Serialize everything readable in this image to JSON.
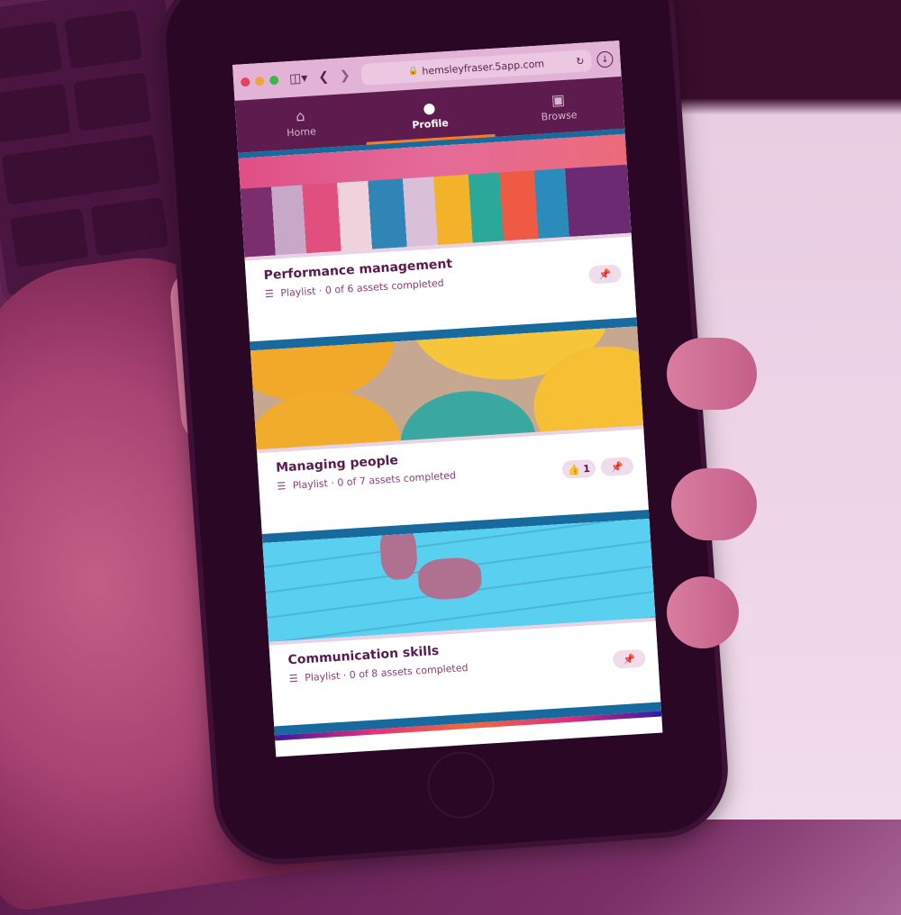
{
  "browser": {
    "url": "hemsleyfraser.5app.com",
    "icons": {
      "sidebar": "sidebar-icon",
      "back": "chevron-left-icon",
      "forward": "chevron-right-icon",
      "lock": "lock-icon",
      "reload": "reload-icon",
      "download": "download-icon"
    },
    "traffic_lights": [
      "#e8425a",
      "#f2a23a",
      "#3cb84a"
    ]
  },
  "nav": {
    "items": [
      {
        "label": "Home",
        "icon": "home-icon",
        "active": false
      },
      {
        "label": "Profile",
        "icon": "user-icon",
        "active": true
      },
      {
        "label": "Browse",
        "icon": "archive-icon",
        "active": false
      }
    ]
  },
  "cards": [
    {
      "title": "Performance management",
      "type": "Playlist",
      "progress": "0 of 6 assets completed",
      "likes": null,
      "image": "colorful wooden planks"
    },
    {
      "title": "Managing people",
      "type": "Playlist",
      "progress": "0 of 7 assets completed",
      "likes": "1",
      "image": "yellow umbrellas"
    },
    {
      "title": "Communication skills",
      "type": "Playlist",
      "progress": "0 of 8 assets completed",
      "likes": null,
      "image": "headphones on blue wood"
    }
  ],
  "colors": {
    "brand": "#5e1b4e",
    "accent": "#f47d2a",
    "divider": "#166a9e"
  },
  "separator": "·"
}
